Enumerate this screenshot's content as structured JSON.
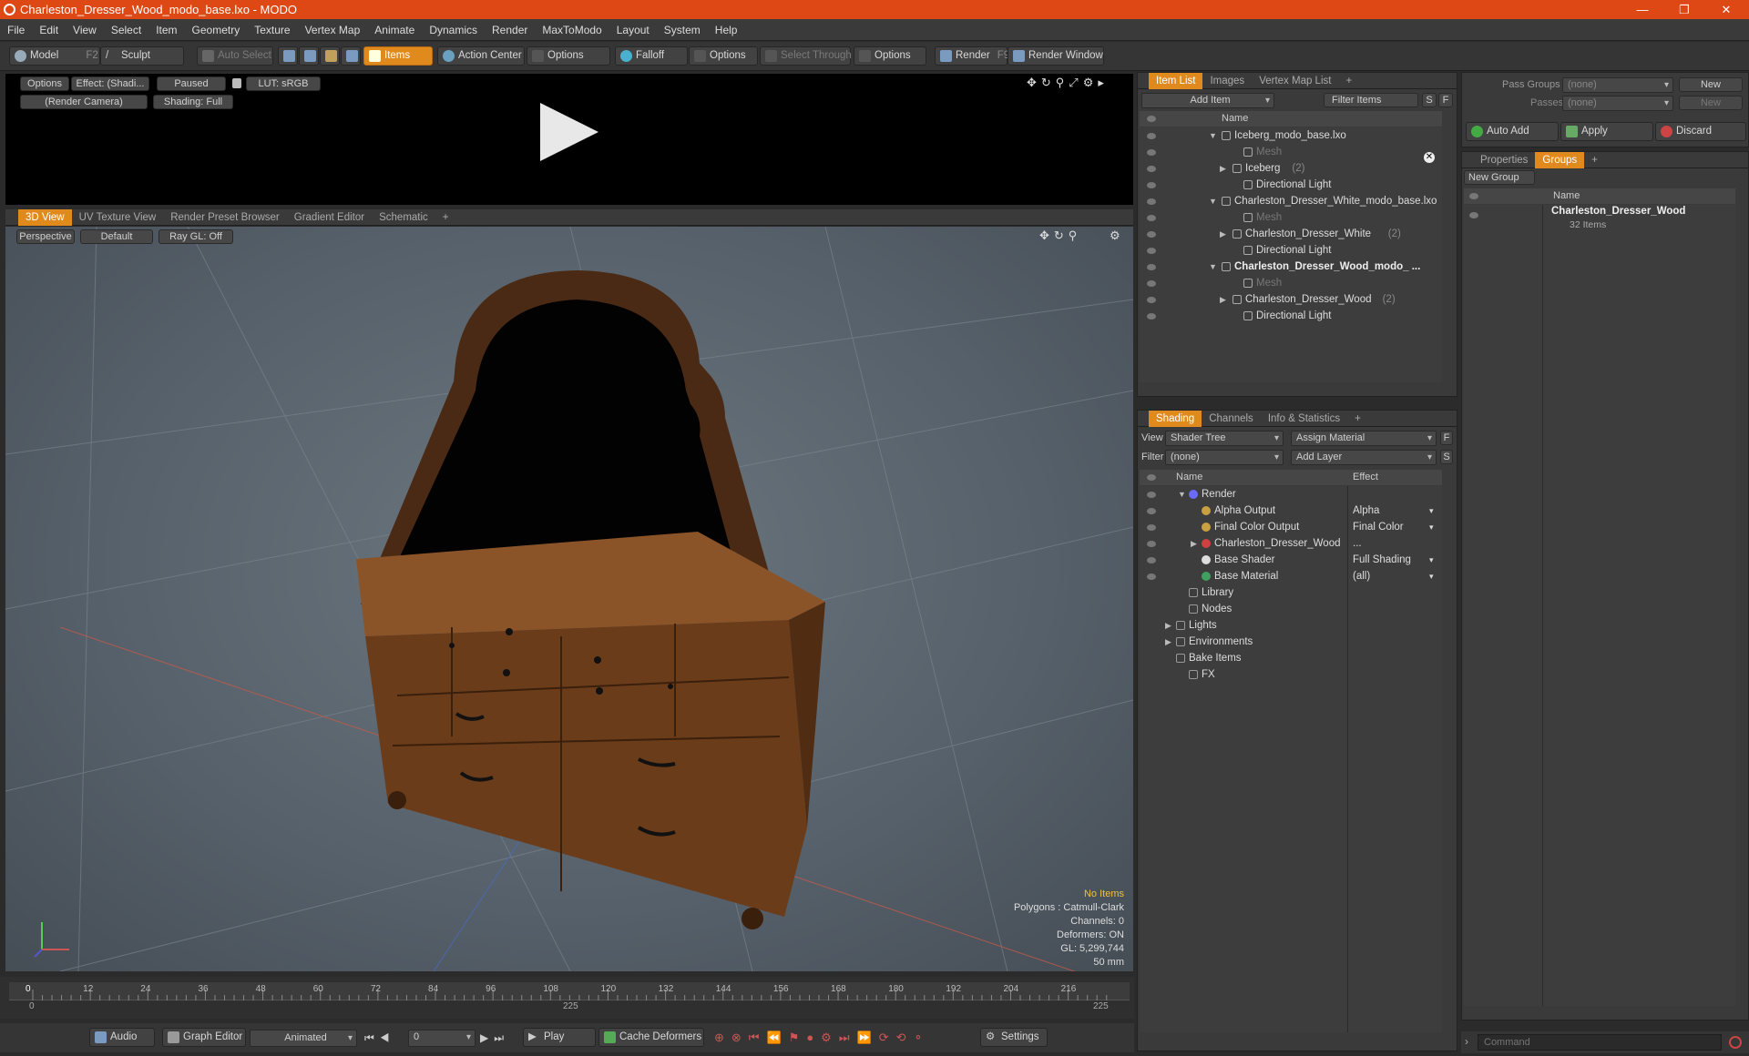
{
  "window": {
    "title": "Charleston_Dresser_Wood_modo_base.lxo - MODO",
    "minimize": "—",
    "restore": "❐",
    "close": "✕"
  },
  "menu": [
    "File",
    "Edit",
    "View",
    "Select",
    "Item",
    "Geometry",
    "Texture",
    "Vertex Map",
    "Animate",
    "Dynamics",
    "Render",
    "MaxToModo",
    "Layout",
    "System",
    "Help"
  ],
  "toolbar": {
    "model": "Model",
    "model_key": "F2",
    "sculpt": "Sculpt",
    "auto_select": "Auto Select",
    "items": "Items",
    "action_center": "Action Center",
    "options1": "Options",
    "falloff": "Falloff",
    "options2": "Options",
    "select_through": "Select Through",
    "options3": "Options",
    "render": "Render",
    "render_key": "F9",
    "render_window": "Render Window"
  },
  "render_preview": {
    "options": "Options",
    "effect": "Effect: (Shadi...",
    "paused": "Paused",
    "lut": "LUT: sRGB",
    "camera": "(Render Camera)",
    "shading": "Shading: Full"
  },
  "viewport_tabs": [
    "3D View",
    "UV Texture View",
    "Render Preset Browser",
    "Gradient Editor",
    "Schematic"
  ],
  "viewport": {
    "perspective": "Perspective",
    "default": "Default",
    "raygl": "Ray GL: Off",
    "info": {
      "no_items": "No Items",
      "polygons": "Polygons : Catmull-Clark",
      "channels": "Channels: 0",
      "deformers": "Deformers: ON",
      "gl": "GL: 5,299,744",
      "mm": "50 mm"
    }
  },
  "timeline": {
    "ticks": [
      "0",
      "12",
      "24",
      "36",
      "48",
      "60",
      "72",
      "84",
      "96",
      "108",
      "120",
      "132",
      "144",
      "156",
      "168",
      "180",
      "192",
      "204",
      "216"
    ],
    "range_start": "0",
    "range_mid": "225",
    "range_end": "225"
  },
  "bottom": {
    "audio": "Audio",
    "graph_editor": "Graph Editor",
    "animated": "Animated",
    "frame": "0",
    "play": "Play",
    "cache_deformers": "Cache Deformers",
    "settings": "Settings"
  },
  "item_list": {
    "tabs": [
      "Item List",
      "Images",
      "Vertex Map List"
    ],
    "add_item": "Add Item",
    "filter_items": "Filter Items",
    "s": "S",
    "f": "F",
    "col_name": "Name",
    "rows": [
      {
        "label": "Iceberg_modo_base.lxo",
        "indent": 0,
        "arrow": "▼",
        "dim": false,
        "bold": false,
        "count": ""
      },
      {
        "label": "Mesh",
        "indent": 2,
        "arrow": "",
        "dim": true,
        "bold": false,
        "count": ""
      },
      {
        "label": "Iceberg",
        "indent": 1,
        "arrow": "▶",
        "dim": false,
        "bold": false,
        "count": "(2)"
      },
      {
        "label": "Directional Light",
        "indent": 2,
        "arrow": "",
        "dim": false,
        "bold": false,
        "count": ""
      },
      {
        "label": "Charleston_Dresser_White_modo_base.lxo",
        "indent": 0,
        "arrow": "▼",
        "dim": false,
        "bold": false,
        "count": ""
      },
      {
        "label": "Mesh",
        "indent": 2,
        "arrow": "",
        "dim": true,
        "bold": false,
        "count": ""
      },
      {
        "label": "Charleston_Dresser_White",
        "indent": 1,
        "arrow": "▶",
        "dim": false,
        "bold": false,
        "count": "(2)"
      },
      {
        "label": "Directional Light",
        "indent": 2,
        "arrow": "",
        "dim": false,
        "bold": false,
        "count": ""
      },
      {
        "label": "Charleston_Dresser_Wood_modo_ ...",
        "indent": 0,
        "arrow": "▼",
        "dim": false,
        "bold": true,
        "count": ""
      },
      {
        "label": "Mesh",
        "indent": 2,
        "arrow": "",
        "dim": true,
        "bold": false,
        "count": ""
      },
      {
        "label": "Charleston_Dresser_Wood",
        "indent": 1,
        "arrow": "▶",
        "dim": false,
        "bold": false,
        "count": "(2)"
      },
      {
        "label": "Directional Light",
        "indent": 2,
        "arrow": "",
        "dim": false,
        "bold": false,
        "count": ""
      }
    ]
  },
  "shading": {
    "tabs": [
      "Shading",
      "Channels",
      "Info & Statistics"
    ],
    "view_label": "View",
    "view_value": "Shader Tree",
    "assign_material": "Assign Material",
    "filter_label": "Filter",
    "filter_value": "(none)",
    "add_layer": "Add Layer",
    "f": "F",
    "s": "S",
    "col_name": "Name",
    "col_effect": "Effect",
    "rows": [
      {
        "label": "Render",
        "effect": "",
        "indent": 0,
        "arrow": "▼",
        "dot": "#6a6aff"
      },
      {
        "label": "Alpha Output",
        "effect": "Alpha",
        "indent": 1,
        "arrow": "",
        "dot": "#c8a040"
      },
      {
        "label": "Final Color Output",
        "effect": "Final Color",
        "indent": 1,
        "arrow": "",
        "dot": "#c8a040"
      },
      {
        "label": "Charleston_Dresser_Wood",
        "effect": "...",
        "indent": 1,
        "arrow": "▶",
        "dot": "#d04040"
      },
      {
        "label": "Base Shader",
        "effect": "Full Shading",
        "indent": 1,
        "arrow": "",
        "dot": "#dddddd"
      },
      {
        "label": "Base Material",
        "effect": "(all)",
        "indent": 1,
        "arrow": "",
        "dot": "#40a060"
      },
      {
        "label": "Library",
        "effect": "",
        "indent": 0,
        "arrow": "",
        "dot": ""
      },
      {
        "label": "Nodes",
        "effect": "",
        "indent": 0,
        "arrow": "",
        "dot": ""
      },
      {
        "label": "Lights",
        "effect": "",
        "indent": -1,
        "arrow": "▶",
        "dot": ""
      },
      {
        "label": "Environments",
        "effect": "",
        "indent": -1,
        "arrow": "▶",
        "dot": ""
      },
      {
        "label": "Bake Items",
        "effect": "",
        "indent": -1,
        "arrow": "",
        "dot": ""
      },
      {
        "label": "FX",
        "effect": "",
        "indent": 0,
        "arrow": "",
        "dot": ""
      }
    ]
  },
  "pass_panel": {
    "pass_groups": "Pass Groups",
    "passes": "Passes",
    "none1": "(none)",
    "none2": "(none)",
    "new1": "New",
    "new2": "New",
    "auto_add": "Auto Add",
    "apply": "Apply",
    "discard": "Discard"
  },
  "groups": {
    "tabs": [
      "Properties",
      "Groups"
    ],
    "new_group": "New Group",
    "col_name": "Name",
    "group_name": "Charleston_Dresser_Wood",
    "group_items": "32 Items"
  },
  "command": {
    "placeholder": "Command"
  },
  "colors": {
    "accent": "#e08a1e",
    "title": "#dd4814"
  }
}
